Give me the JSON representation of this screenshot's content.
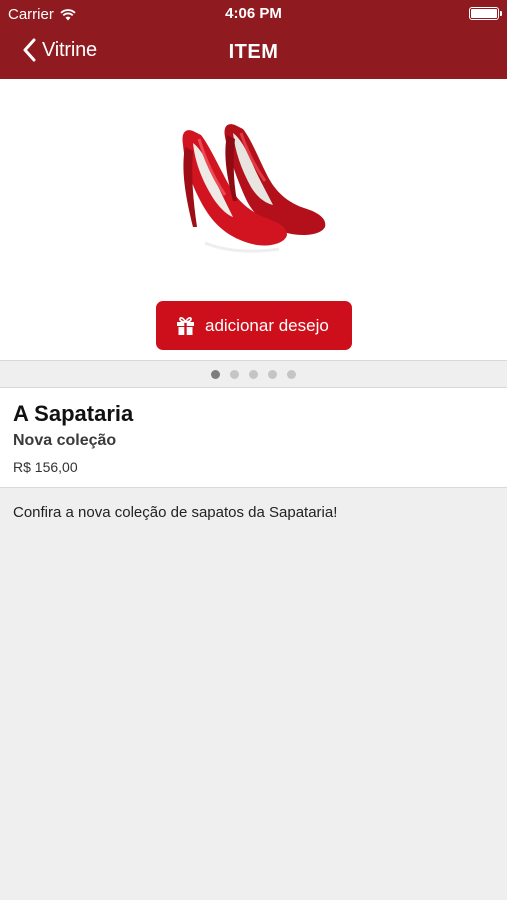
{
  "status_bar": {
    "carrier": "Carrier",
    "time": "4:06 PM"
  },
  "navbar": {
    "back_label": "Vitrine",
    "title": "ITEM"
  },
  "product": {
    "wish_button_label": "adicionar desejo",
    "image_pages": 5,
    "active_page": 1,
    "name": "A Sapataria",
    "subtitle": "Nova coleção",
    "price": "R$ 156,00",
    "description": "Confira a nova coleção de sapatos da Sapataria!"
  },
  "colors": {
    "navbar": "#8f1a1f",
    "button": "#cc0f1a",
    "background": "#efefef"
  }
}
